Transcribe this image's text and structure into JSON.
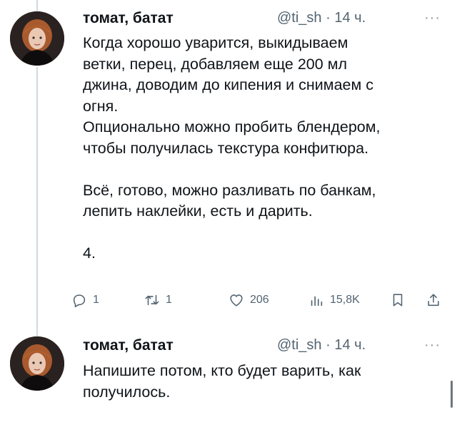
{
  "tweets": [
    {
      "author_name": "томат, батат",
      "handle": "@ti_sh",
      "time": "14 ч.",
      "more": "···",
      "lines": [
        "Когда хорошо уварится, выкидываем",
        "ветки, перец, добавляем еще 200 мл",
        "джина, доводим до кипения и снимаем с",
        "огня.",
        "Опционально можно пробить блендером,",
        "чтобы получилась текстура конфитюра.",
        "",
        "Всё, готово, можно разливать по банкам,",
        "лепить наклейки, есть и дарить.",
        "",
        "4."
      ],
      "actions": {
        "replies": "1",
        "retweets": "1",
        "likes": "206",
        "views": "15,8K"
      }
    },
    {
      "author_name": "томат, батат",
      "handle": "@ti_sh",
      "time": "14 ч.",
      "more": "···",
      "lines": [
        "Напишите потом, кто будет варить, как",
        "получилось."
      ]
    }
  ],
  "icons": {
    "reply": "reply-icon",
    "retweet": "retweet-icon",
    "like": "heart-icon",
    "views": "views-icon",
    "bookmark": "bookmark-icon",
    "share": "share-icon"
  },
  "colors": {
    "text": "#0f1419",
    "secondary": "#536471",
    "thread_line": "#cfd9de"
  }
}
